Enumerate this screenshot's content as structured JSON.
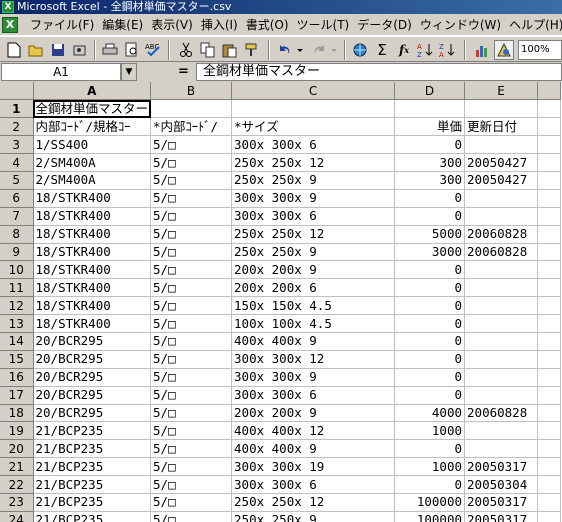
{
  "window": {
    "title": "Microsoft Excel - 全鋼材単価マスター.csv"
  },
  "menu": [
    "ファイル(F)",
    "編集(E)",
    "表示(V)",
    "挿入(I)",
    "書式(O)",
    "ツール(T)",
    "データ(D)",
    "ウィンドウ(W)",
    "ヘルプ(H)"
  ],
  "toolbar": {
    "zoom": "100%"
  },
  "formula_bar": {
    "cell_ref": "A1",
    "equals": "=",
    "content": "全鋼材単価マスター"
  },
  "grid": {
    "columns": [
      "A",
      "B",
      "C",
      "D",
      "E",
      ""
    ],
    "rows": [
      {
        "n": "1",
        "a": "全鋼材単価マスター",
        "b": "",
        "c": "",
        "d": "",
        "e": ""
      },
      {
        "n": "2",
        "a": "内部ｺｰﾄﾞ/規格ｺｰ",
        "b": "*内部ｺｰﾄﾞ/",
        "c": "*サイズ",
        "d": "単価",
        "e": "更新日付"
      },
      {
        "n": "3",
        "a": "1/SS400",
        "b": "5/□",
        "c": "300x 300x  6",
        "d": "0",
        "e": ""
      },
      {
        "n": "4",
        "a": "2/SM400A",
        "b": "5/□",
        "c": "250x 250x 12",
        "d": "300",
        "e": "20050427"
      },
      {
        "n": "5",
        "a": "2/SM400A",
        "b": "5/□",
        "c": "250x 250x  9",
        "d": "300",
        "e": "20050427"
      },
      {
        "n": "6",
        "a": "18/STKR400",
        "b": "5/□",
        "c": "300x 300x  9",
        "d": "0",
        "e": ""
      },
      {
        "n": "7",
        "a": "18/STKR400",
        "b": "5/□",
        "c": "300x 300x  6",
        "d": "0",
        "e": ""
      },
      {
        "n": "8",
        "a": "18/STKR400",
        "b": "5/□",
        "c": "250x 250x 12",
        "d": "5000",
        "e": "20060828"
      },
      {
        "n": "9",
        "a": "18/STKR400",
        "b": "5/□",
        "c": "250x 250x  9",
        "d": "3000",
        "e": "20060828"
      },
      {
        "n": "10",
        "a": "18/STKR400",
        "b": "5/□",
        "c": "200x 200x  9",
        "d": "0",
        "e": ""
      },
      {
        "n": "11",
        "a": "18/STKR400",
        "b": "5/□",
        "c": "200x 200x  6",
        "d": "0",
        "e": ""
      },
      {
        "n": "12",
        "a": "18/STKR400",
        "b": "5/□",
        "c": "150x 150x 4.5",
        "d": "0",
        "e": ""
      },
      {
        "n": "13",
        "a": "18/STKR400",
        "b": "5/□",
        "c": "100x 100x 4.5",
        "d": "0",
        "e": ""
      },
      {
        "n": "14",
        "a": "20/BCR295",
        "b": "5/□",
        "c": "400x 400x  9",
        "d": "0",
        "e": ""
      },
      {
        "n": "15",
        "a": "20/BCR295",
        "b": "5/□",
        "c": "300x 300x 12",
        "d": "0",
        "e": ""
      },
      {
        "n": "16",
        "a": "20/BCR295",
        "b": "5/□",
        "c": "300x 300x  9",
        "d": "0",
        "e": ""
      },
      {
        "n": "17",
        "a": "20/BCR295",
        "b": "5/□",
        "c": "300x 300x  6",
        "d": "0",
        "e": ""
      },
      {
        "n": "18",
        "a": "20/BCR295",
        "b": "5/□",
        "c": "200x 200x  9",
        "d": "4000",
        "e": "20060828"
      },
      {
        "n": "19",
        "a": "21/BCP235",
        "b": "5/□",
        "c": "400x 400x 12",
        "d": "1000",
        "e": ""
      },
      {
        "n": "20",
        "a": "21/BCP235",
        "b": "5/□",
        "c": "400x 400x  9",
        "d": "0",
        "e": ""
      },
      {
        "n": "21",
        "a": "21/BCP235",
        "b": "5/□",
        "c": "300x 300x 19",
        "d": "1000",
        "e": "20050317"
      },
      {
        "n": "22",
        "a": "21/BCP235",
        "b": "5/□",
        "c": "300x 300x  6",
        "d": "0",
        "e": "20050304"
      },
      {
        "n": "23",
        "a": "21/BCP235",
        "b": "5/□",
        "c": "250x 250x 12",
        "d": "100000",
        "e": "20050317"
      },
      {
        "n": "24",
        "a": "21/BCP235",
        "b": "5/□",
        "c": "250x 250x  9",
        "d": "100000",
        "e": "20050317"
      }
    ]
  }
}
